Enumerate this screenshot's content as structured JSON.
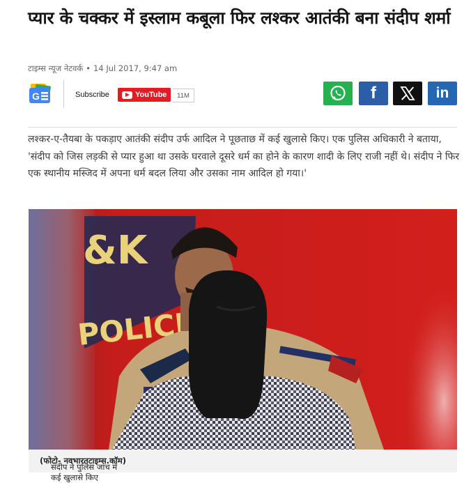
{
  "article": {
    "headline": "प्यार के चक्कर में इस्लाम कबूला फिर लश्कर आतंकी बना संदीप शर्मा",
    "source": "टाइम्स न्यूज नेटवर्क",
    "date": "14 Jul 2017, 9:47 am",
    "body": "लश्कर-ए-तैयबा के पकड़ाए आतंकी संदीप उर्फ आदिल ने पूछताछ में कई खुलासे किए। एक पुलिस अधिकारी ने बताया, 'संदीप को जिस लड़की से प्यार हुआ था उसके घरवाले दूसरे धर्म का होने के कारण शादी के लिए राजी नहीं थे। संदीप ने फिर एक स्थानीय मस्जिद में अपना धर्म बदल लिया और उसका नाम आदिल हो गया।'",
    "caption_text": "संदीप ने पुलिस जांच में कई खुलासे किए",
    "caption_credit": "(फोटो- नवभारतटाइम्स.कॉम)"
  },
  "toolbar": {
    "subscribe_label": "Subscribe",
    "youtube_label": "YouTube",
    "subscriber_count": "11M"
  },
  "share": {
    "whatsapp": "whatsapp-icon",
    "facebook": "facebook-icon",
    "x": "x-icon",
    "linkedin": "linkedin-icon",
    "linkedin_text": "in",
    "facebook_text": "f"
  },
  "photo": {
    "sign_letters": "&K",
    "sign_word": "POLICE"
  },
  "colors": {
    "youtube_red": "#e31b23",
    "whatsapp_green": "#26b150",
    "facebook_blue": "#2c5ea8",
    "x_black": "#111111",
    "linkedin_blue": "#2567b3"
  }
}
